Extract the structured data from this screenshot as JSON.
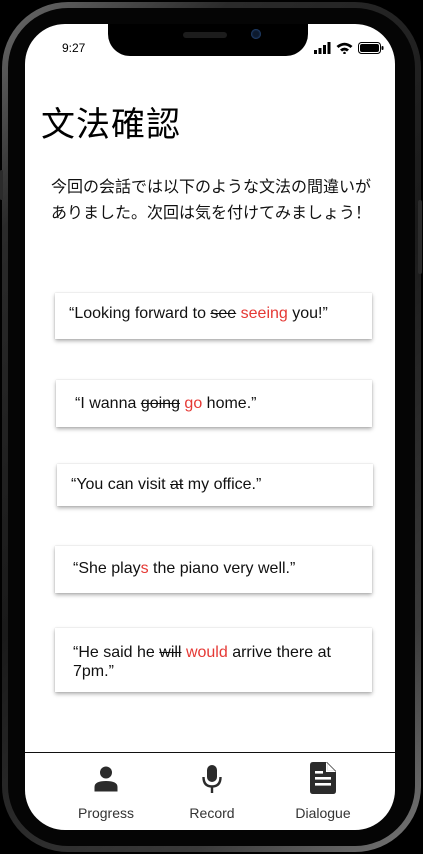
{
  "status_bar": {
    "time": "9:27",
    "icons": [
      "signal-icon",
      "wifi-icon",
      "battery-icon"
    ]
  },
  "page": {
    "title": "文法確認",
    "intro": "今回の会話では以下のような文法の間違いがありました。次回は気を付けてみましょう！"
  },
  "colors": {
    "correction": "#e53935",
    "text": "#111111",
    "background": "#ffffff"
  },
  "corrections": [
    {
      "open": "“Looking forward to ",
      "wrong": "see",
      "sep": " ",
      "fix": "seeing",
      "rest": " you!”"
    },
    {
      "open": "“I wanna ",
      "wrong": "going",
      "sep": " ",
      "fix": "go",
      "rest": " home.”"
    },
    {
      "open": "“You can visit ",
      "wrong": "at",
      "rest": " my office.”"
    },
    {
      "open": "“She play",
      "fix": "s",
      "rest": " the piano very well.”"
    },
    {
      "open": "“He said he ",
      "wrong": "will",
      "sep": " ",
      "fix": "would",
      "rest": " arrive there at 7pm.”"
    }
  ],
  "nav": {
    "items": [
      {
        "label": "Progress",
        "icon": "person-icon"
      },
      {
        "label": "Record",
        "icon": "microphone-icon"
      },
      {
        "label": "Dialogue",
        "icon": "document-icon"
      }
    ]
  }
}
